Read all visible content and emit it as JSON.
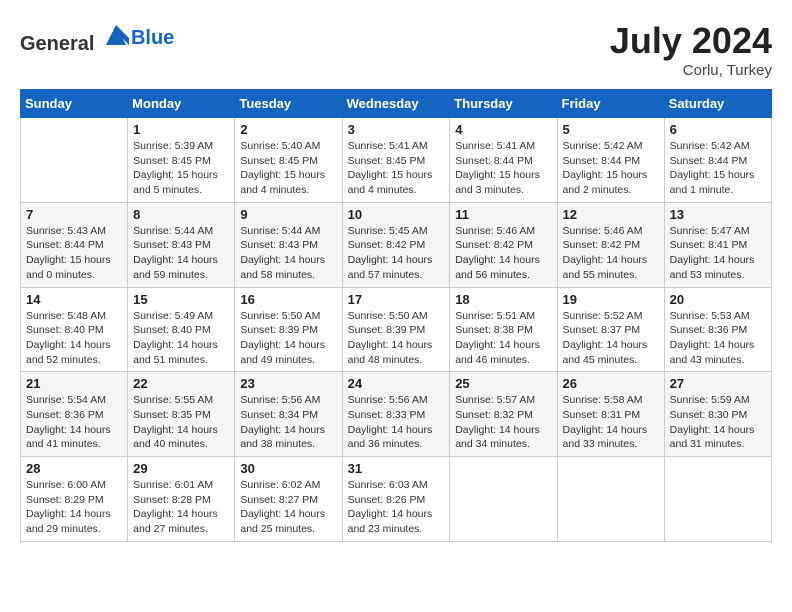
{
  "header": {
    "logo_general": "General",
    "logo_blue": "Blue",
    "month_year": "July 2024",
    "location": "Corlu, Turkey"
  },
  "weekdays": [
    "Sunday",
    "Monday",
    "Tuesday",
    "Wednesday",
    "Thursday",
    "Friday",
    "Saturday"
  ],
  "weeks": [
    [
      {
        "day": "",
        "info": ""
      },
      {
        "day": "1",
        "info": "Sunrise: 5:39 AM\nSunset: 8:45 PM\nDaylight: 15 hours\nand 5 minutes."
      },
      {
        "day": "2",
        "info": "Sunrise: 5:40 AM\nSunset: 8:45 PM\nDaylight: 15 hours\nand 4 minutes."
      },
      {
        "day": "3",
        "info": "Sunrise: 5:41 AM\nSunset: 8:45 PM\nDaylight: 15 hours\nand 4 minutes."
      },
      {
        "day": "4",
        "info": "Sunrise: 5:41 AM\nSunset: 8:44 PM\nDaylight: 15 hours\nand 3 minutes."
      },
      {
        "day": "5",
        "info": "Sunrise: 5:42 AM\nSunset: 8:44 PM\nDaylight: 15 hours\nand 2 minutes."
      },
      {
        "day": "6",
        "info": "Sunrise: 5:42 AM\nSunset: 8:44 PM\nDaylight: 15 hours\nand 1 minute."
      }
    ],
    [
      {
        "day": "7",
        "info": "Sunrise: 5:43 AM\nSunset: 8:44 PM\nDaylight: 15 hours\nand 0 minutes."
      },
      {
        "day": "8",
        "info": "Sunrise: 5:44 AM\nSunset: 8:43 PM\nDaylight: 14 hours\nand 59 minutes."
      },
      {
        "day": "9",
        "info": "Sunrise: 5:44 AM\nSunset: 8:43 PM\nDaylight: 14 hours\nand 58 minutes."
      },
      {
        "day": "10",
        "info": "Sunrise: 5:45 AM\nSunset: 8:42 PM\nDaylight: 14 hours\nand 57 minutes."
      },
      {
        "day": "11",
        "info": "Sunrise: 5:46 AM\nSunset: 8:42 PM\nDaylight: 14 hours\nand 56 minutes."
      },
      {
        "day": "12",
        "info": "Sunrise: 5:46 AM\nSunset: 8:42 PM\nDaylight: 14 hours\nand 55 minutes."
      },
      {
        "day": "13",
        "info": "Sunrise: 5:47 AM\nSunset: 8:41 PM\nDaylight: 14 hours\nand 53 minutes."
      }
    ],
    [
      {
        "day": "14",
        "info": "Sunrise: 5:48 AM\nSunset: 8:40 PM\nDaylight: 14 hours\nand 52 minutes."
      },
      {
        "day": "15",
        "info": "Sunrise: 5:49 AM\nSunset: 8:40 PM\nDaylight: 14 hours\nand 51 minutes."
      },
      {
        "day": "16",
        "info": "Sunrise: 5:50 AM\nSunset: 8:39 PM\nDaylight: 14 hours\nand 49 minutes."
      },
      {
        "day": "17",
        "info": "Sunrise: 5:50 AM\nSunset: 8:39 PM\nDaylight: 14 hours\nand 48 minutes."
      },
      {
        "day": "18",
        "info": "Sunrise: 5:51 AM\nSunset: 8:38 PM\nDaylight: 14 hours\nand 46 minutes."
      },
      {
        "day": "19",
        "info": "Sunrise: 5:52 AM\nSunset: 8:37 PM\nDaylight: 14 hours\nand 45 minutes."
      },
      {
        "day": "20",
        "info": "Sunrise: 5:53 AM\nSunset: 8:36 PM\nDaylight: 14 hours\nand 43 minutes."
      }
    ],
    [
      {
        "day": "21",
        "info": "Sunrise: 5:54 AM\nSunset: 8:36 PM\nDaylight: 14 hours\nand 41 minutes."
      },
      {
        "day": "22",
        "info": "Sunrise: 5:55 AM\nSunset: 8:35 PM\nDaylight: 14 hours\nand 40 minutes."
      },
      {
        "day": "23",
        "info": "Sunrise: 5:56 AM\nSunset: 8:34 PM\nDaylight: 14 hours\nand 38 minutes."
      },
      {
        "day": "24",
        "info": "Sunrise: 5:56 AM\nSunset: 8:33 PM\nDaylight: 14 hours\nand 36 minutes."
      },
      {
        "day": "25",
        "info": "Sunrise: 5:57 AM\nSunset: 8:32 PM\nDaylight: 14 hours\nand 34 minutes."
      },
      {
        "day": "26",
        "info": "Sunrise: 5:58 AM\nSunset: 8:31 PM\nDaylight: 14 hours\nand 33 minutes."
      },
      {
        "day": "27",
        "info": "Sunrise: 5:59 AM\nSunset: 8:30 PM\nDaylight: 14 hours\nand 31 minutes."
      }
    ],
    [
      {
        "day": "28",
        "info": "Sunrise: 6:00 AM\nSunset: 8:29 PM\nDaylight: 14 hours\nand 29 minutes."
      },
      {
        "day": "29",
        "info": "Sunrise: 6:01 AM\nSunset: 8:28 PM\nDaylight: 14 hours\nand 27 minutes."
      },
      {
        "day": "30",
        "info": "Sunrise: 6:02 AM\nSunset: 8:27 PM\nDaylight: 14 hours\nand 25 minutes."
      },
      {
        "day": "31",
        "info": "Sunrise: 6:03 AM\nSunset: 8:26 PM\nDaylight: 14 hours\nand 23 minutes."
      },
      {
        "day": "",
        "info": ""
      },
      {
        "day": "",
        "info": ""
      },
      {
        "day": "",
        "info": ""
      }
    ]
  ]
}
